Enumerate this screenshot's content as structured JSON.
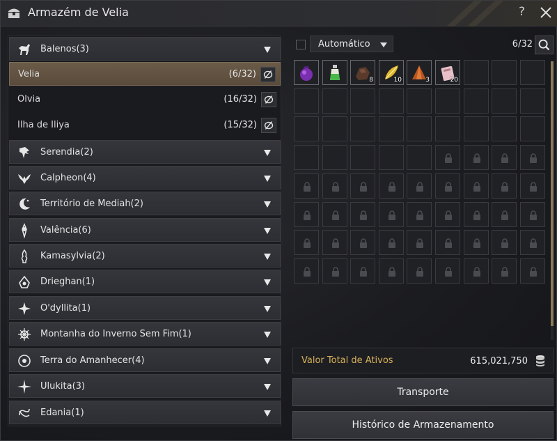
{
  "window": {
    "title": "Armazém de Velia",
    "help_label": "?"
  },
  "regions_top": {
    "balenos": {
      "label": "Balenos(3)",
      "icon": "horse-icon"
    }
  },
  "nodes": [
    {
      "label": "Velia",
      "count": "(6/32)",
      "active": true
    },
    {
      "label": "Olvia",
      "count": "(16/32)",
      "active": false
    },
    {
      "label": "Ilha de Iliya",
      "count": "(15/32)",
      "active": false
    }
  ],
  "regions": [
    {
      "label": "Serendia(2)",
      "icon": "eagle-icon"
    },
    {
      "label": "Calpheon(4)",
      "icon": "griffin-icon"
    },
    {
      "label": "Território de Mediah(2)",
      "icon": "moon-icon"
    },
    {
      "label": "Valência(6)",
      "icon": "sun-emblem-icon"
    },
    {
      "label": "Kamasylvia(2)",
      "icon": "tree-icon"
    },
    {
      "label": "Drieghan(1)",
      "icon": "dragon-icon"
    },
    {
      "label": "O'dyllita(1)",
      "icon": "star-emblem-icon"
    },
    {
      "label": "Montanha do Inverno Sem Fim(1)",
      "icon": "snowflake-icon"
    },
    {
      "label": "Terra do Amanhecer(4)",
      "icon": "dawn-wheel-icon"
    },
    {
      "label": "Ulukita(3)",
      "icon": "compass-star-icon"
    },
    {
      "label": "Edania(1)",
      "icon": "knot-icon"
    }
  ],
  "storage": {
    "sort_label": "Automático",
    "slots_used": "6/32",
    "items": [
      {
        "icon": "purple-pouch-icon",
        "qty": ""
      },
      {
        "icon": "green-potion-icon",
        "qty": ""
      },
      {
        "icon": "brown-ore-icon",
        "qty": "8"
      },
      {
        "icon": "gold-leaf-icon",
        "qty": "10"
      },
      {
        "icon": "copper-ore-icon",
        "qty": "3"
      },
      {
        "icon": "pink-card-icon",
        "qty": "20"
      }
    ],
    "unlocked_slots": 32,
    "total_slots": 72,
    "total_label": "Valor Total de Ativos",
    "total_value": "615,021,750",
    "transport_label": "Transporte",
    "history_label": "Histórico de Armazenamento"
  },
  "colors": {
    "accent_gold": "#d8b25a",
    "active_node": "#6a5a48"
  }
}
